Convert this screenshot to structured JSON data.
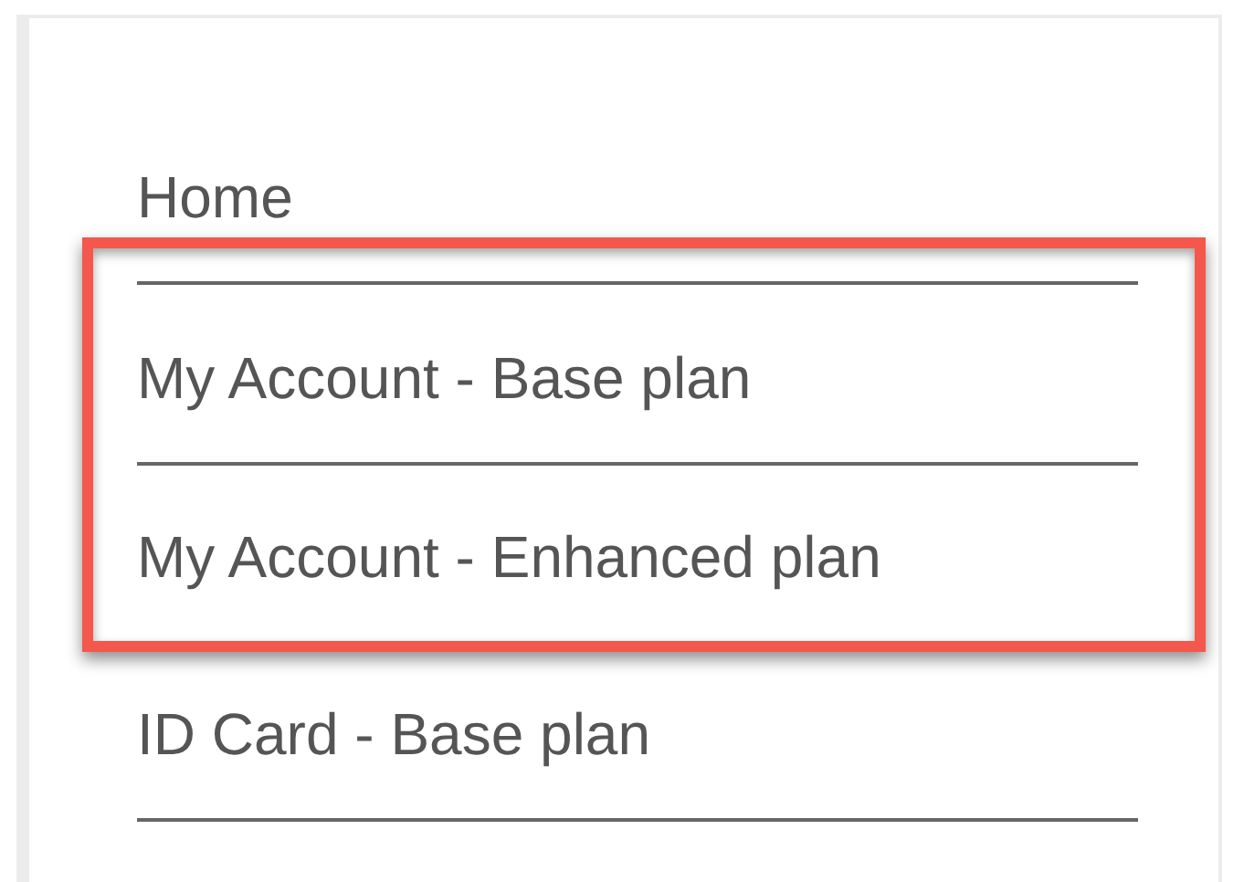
{
  "menu": {
    "items": [
      {
        "label": "Home",
        "highlighted": false
      },
      {
        "label": "My Account - Base plan",
        "highlighted": true
      },
      {
        "label": "My Account - Enhanced plan",
        "highlighted": true
      },
      {
        "label": "ID Card - Base plan",
        "highlighted": false
      }
    ]
  }
}
